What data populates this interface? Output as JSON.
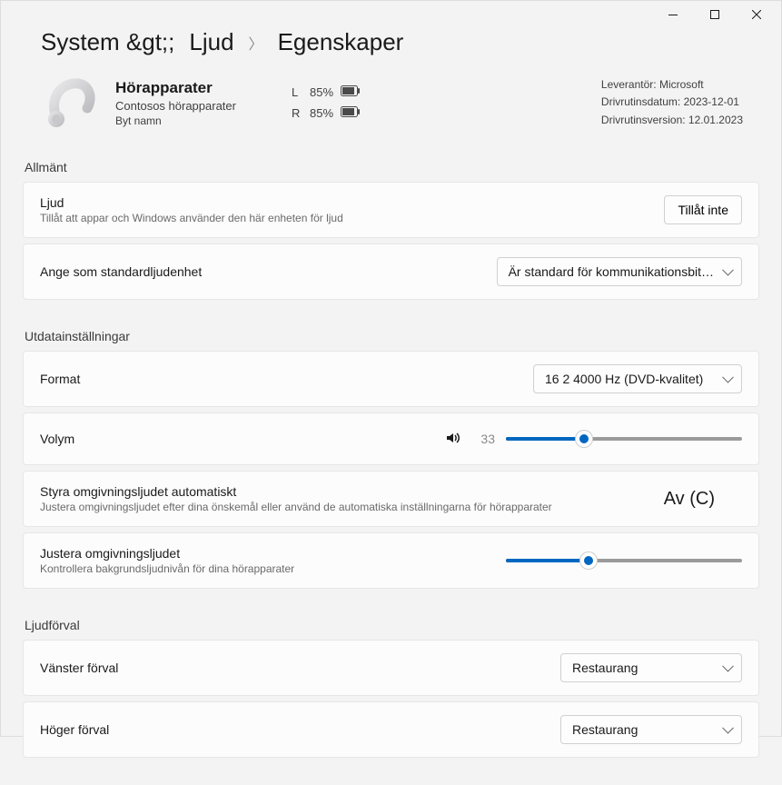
{
  "breadcrumb": {
    "system": "System &gt;;",
    "sound": "Ljud",
    "properties": "Egenskaper"
  },
  "device": {
    "title": "Hörapparater",
    "subtitle": "Contosos hörapparater",
    "rename": "Byt namn",
    "battery": {
      "left_label": "L",
      "left_pct": "85%",
      "right_label": "R",
      "right_pct": "85%"
    }
  },
  "driver": {
    "vendor": "Leverantör: Microsoft",
    "date": "Drivrutinsdatum: 2023-12-01",
    "version": "Drivrutinsversion: 12.01.2023"
  },
  "sections": {
    "general": "Allmänt",
    "output": "Utdatainställningar",
    "presets": "Ljudförval"
  },
  "general": {
    "audio": {
      "title": "Ljud",
      "sub": "Tillåt att appar och Windows använder den här enheten för ljud",
      "button": "Tillåt inte"
    },
    "default": {
      "title": "Ange som standardljudenhet",
      "select": "Är standard för kommunikationsbit…"
    }
  },
  "output": {
    "format": {
      "title": "Format",
      "select": "16 2 4000 Hz (DVD-kvalitet)"
    },
    "volume": {
      "title": "Volym",
      "value": "33",
      "percent": 33
    },
    "ambient_auto": {
      "title": "Styra omgivningsljudet automatiskt",
      "sub": "Justera omgivningsljudet efter dina önskemål eller använd de automatiska inställningarna för hörapparater",
      "status": "Av (C)"
    },
    "ambient_adjust": {
      "title": "Justera omgivningsljudet",
      "sub": "Kontrollera bakgrundsljudnivån för dina hörapparater",
      "percent": 35
    }
  },
  "presets": {
    "left": {
      "title": "Vänster förval",
      "select": "Restaurang"
    },
    "right": {
      "title": "Höger förval",
      "select": "Restaurang"
    }
  }
}
